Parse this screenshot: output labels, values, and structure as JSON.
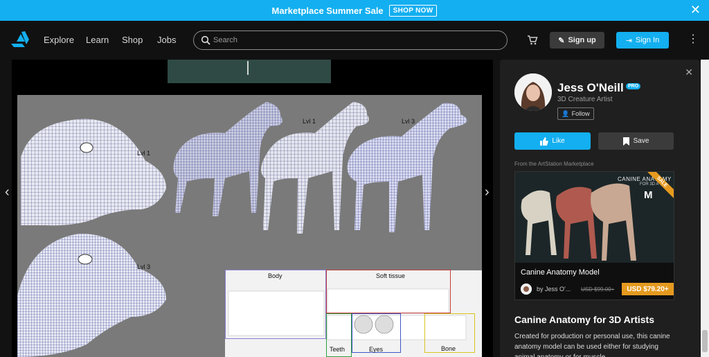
{
  "banner": {
    "text": "Marketplace Summer Sale",
    "cta": "SHOP NOW",
    "close_icon": "close-icon"
  },
  "nav": {
    "links": [
      "Explore",
      "Learn",
      "Shop",
      "Jobs"
    ],
    "search_placeholder": "Search",
    "signup": "Sign up",
    "signin": "Sign In",
    "icons": [
      "artstation-logo-icon",
      "search-icon",
      "cart-icon",
      "pencil-icon",
      "sign-in-icon",
      "kebab-menu-icon"
    ]
  },
  "viewer": {
    "labels": {
      "lvl1_head": "Lvl 1",
      "lvl1_body": "Lvl 1",
      "lvl3_body": "Lvl 3",
      "lvl3_head": "Lvl 3"
    },
    "uv": {
      "body": "Body",
      "soft": "Soft tissue",
      "teeth": "Teeth",
      "eyes": "Eyes",
      "bone": "Bone"
    }
  },
  "artist": {
    "name": "Jess O'Neill",
    "badge": "PRO",
    "title": "3D Creature Artist",
    "follow": "Follow"
  },
  "actions": {
    "like": "Like",
    "save": "Save"
  },
  "marketplace": {
    "heading": "From the ArtStation Marketplace",
    "product_title": "Canine Anatomy Model",
    "by": "by Jess O'...",
    "old_price": "USD $99.00+",
    "price": "USD $79.20+",
    "ribbon": "SALE",
    "banner_title": "CANINE ANATOMY",
    "banner_sub": "FOR 3D A"
  },
  "project": {
    "title": "Canine Anatomy for 3D Artists",
    "description": "Created for production or personal use, this canine anatomy model can be used either for studying animal anatomy or for muscle"
  },
  "colors": {
    "accent": "#13aff0",
    "sale": "#e59a1f",
    "background": "#121212",
    "panel": "#1f1f1f"
  }
}
